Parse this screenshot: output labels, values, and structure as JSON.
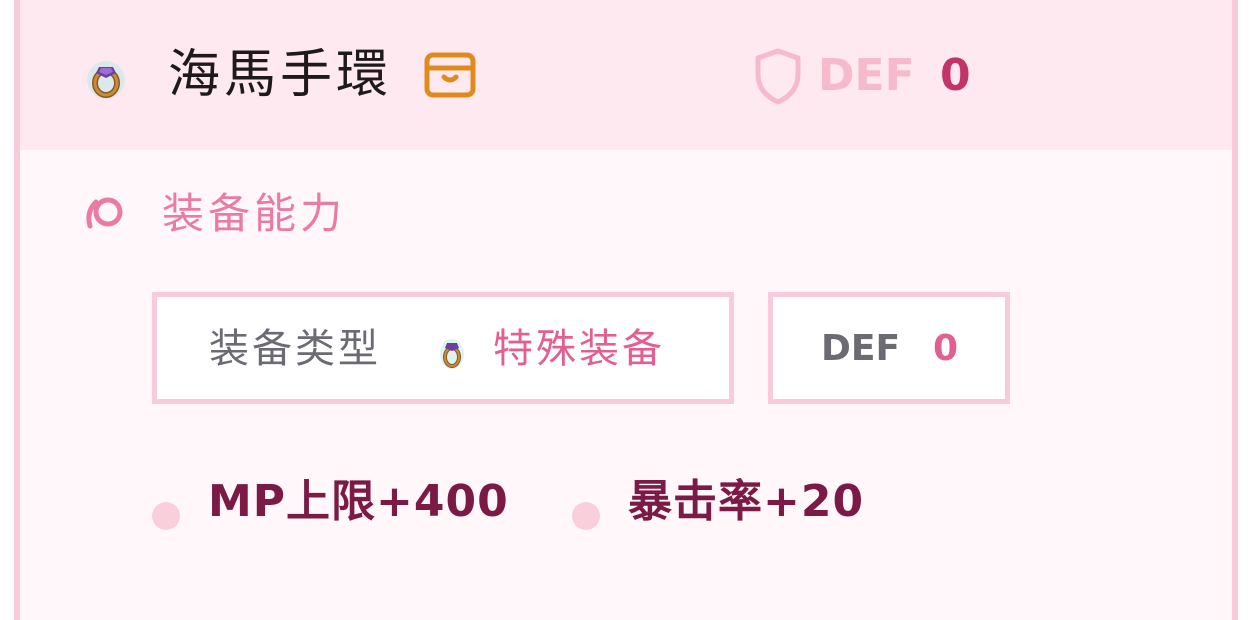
{
  "item": {
    "name": "海馬手環",
    "icon": "ring-icon",
    "bag_icon": "bag-icon"
  },
  "header_stat": {
    "icon": "shield-icon",
    "label": "DEF",
    "value": "0"
  },
  "section": {
    "icon": "swirl-icon",
    "title": "装备能力"
  },
  "equipment_type": {
    "label": "装备类型",
    "icon": "ring-icon",
    "value": "特殊装备"
  },
  "def_box": {
    "label": "DEF",
    "value": "0"
  },
  "stats": [
    {
      "text": "MP上限+400"
    },
    {
      "text": "暴击率+20"
    }
  ],
  "colors": {
    "card_border": "#f8cadb",
    "header_bg": "#ffe9f0",
    "accent_pink": "#e35f92",
    "accent_dark": "#7a1a45",
    "muted_gray": "#6c6a73"
  }
}
